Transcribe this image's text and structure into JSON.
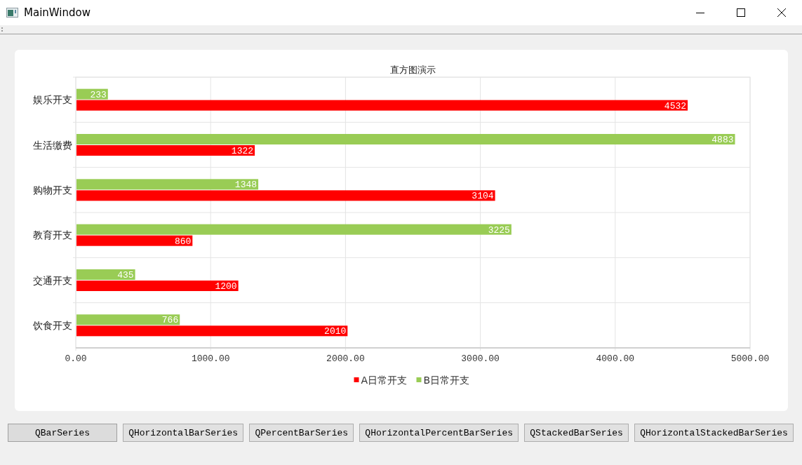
{
  "window": {
    "title": "MainWindow"
  },
  "chart": {
    "chart_data": {
      "type": "bar",
      "orientation": "horizontal",
      "title": "直方图演示",
      "categories": [
        "娱乐开支",
        "生活缴费",
        "购物开支",
        "教育开支",
        "交通开支",
        "饮食开支"
      ],
      "series": [
        {
          "name": "A日常开支",
          "color": "#ff0000",
          "values": [
            4532,
            1322,
            3104,
            860,
            1200,
            2010
          ]
        },
        {
          "name": "B日常开支",
          "color": "#99cc55",
          "values": [
            233,
            4883,
            1348,
            3225,
            435,
            766
          ]
        }
      ],
      "grid": true,
      "legend": true,
      "xlim": [
        0,
        5000
      ],
      "xticks": [
        {
          "value": 0,
          "label": "0.00"
        },
        {
          "value": 1000,
          "label": "1000.00"
        },
        {
          "value": 2000,
          "label": "2000.00"
        },
        {
          "value": 3000,
          "label": "3000.00"
        },
        {
          "value": 4000,
          "label": "4000.00"
        },
        {
          "value": 5000,
          "label": "5000.00"
        }
      ],
      "data_labels": true
    }
  },
  "buttons": [
    {
      "label": "QBarSeries",
      "selected": true
    },
    {
      "label": "QHorizontalBarSeries",
      "selected": false
    },
    {
      "label": "QPercentBarSeries",
      "selected": false
    },
    {
      "label": "QHorizontalPercentBarSeries",
      "selected": false
    },
    {
      "label": "QStackedBarSeries",
      "selected": false
    },
    {
      "label": "QHorizontalStackedBarSeries",
      "selected": false
    }
  ]
}
